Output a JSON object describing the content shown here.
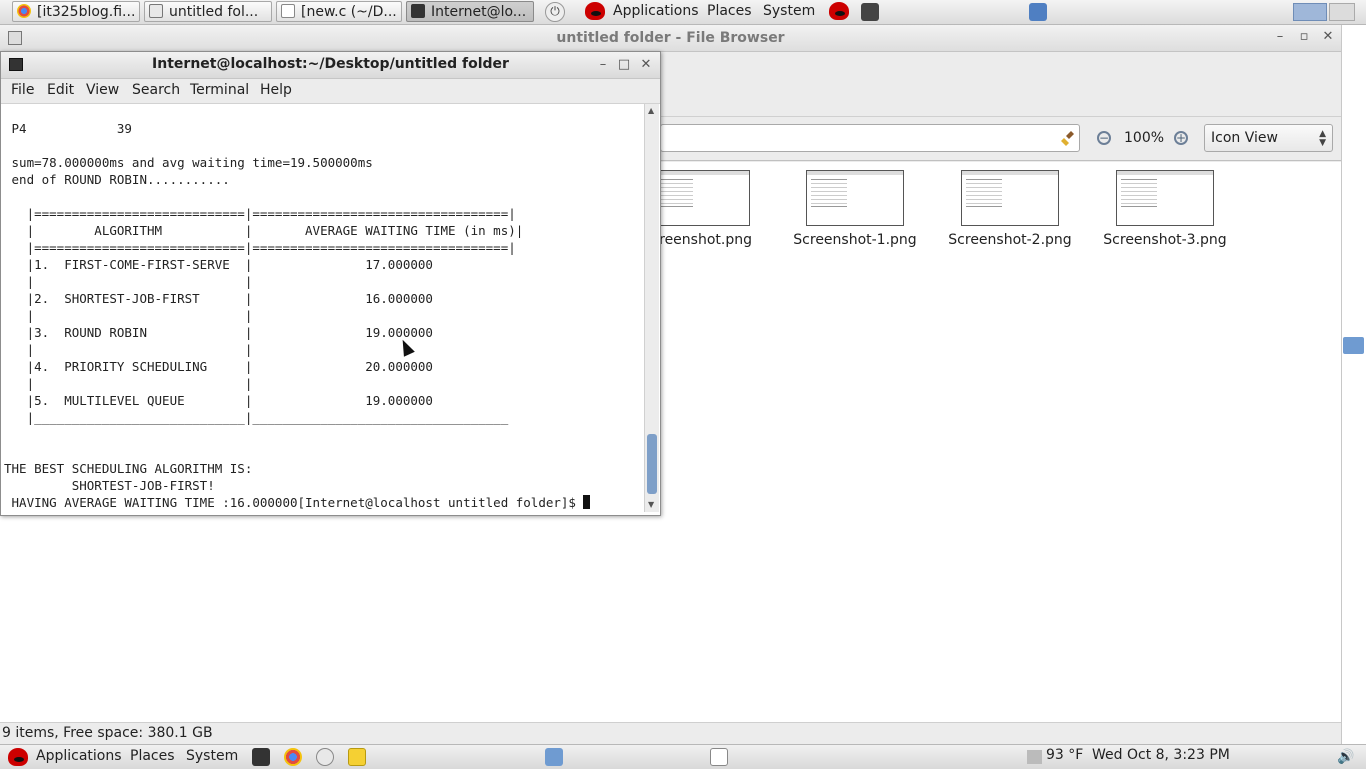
{
  "top_panel": {
    "tasks": [
      {
        "label": "[it325blog.fi..."
      },
      {
        "label": "untitled fol..."
      },
      {
        "label": "[new.c (~/D..."
      },
      {
        "label": "Internet@lo..."
      }
    ],
    "menus": {
      "applications": "Applications",
      "places": "Places",
      "system": "System"
    }
  },
  "file_browser": {
    "title": "untitled folder - File Browser",
    "zoom": "100%",
    "view_mode": "Icon View",
    "files": [
      {
        "name": "creenshot.png"
      },
      {
        "name": "Screenshot-1.png"
      },
      {
        "name": "Screenshot-2.png"
      },
      {
        "name": "Screenshot-3.png"
      }
    ],
    "status": "9 items, Free space: 380.1 GB"
  },
  "terminal": {
    "title": "Internet@localhost:~/Desktop/untitled folder",
    "menu": {
      "file": "File",
      "edit": "Edit",
      "view": "View",
      "search": "Search",
      "terminal": "Terminal",
      "help": "Help"
    },
    "lines": [
      " P4            39",
      "",
      " sum=78.000000ms and avg waiting time=19.500000ms",
      " end of ROUND ROBIN...........",
      "",
      "   |============================|==================================|",
      "   |        ALGORITHM           |       AVERAGE WAITING TIME (in ms)|",
      "   |============================|==================================|",
      "   |1.  FIRST-COME-FIRST-SERVE  |               17.000000",
      "   |                            |",
      "   |2.  SHORTEST-JOB-FIRST      |               16.000000",
      "   |                            |",
      "   |3.  ROUND ROBIN             |               19.000000",
      "   |                            |",
      "   |4.  PRIORITY SCHEDULING     |               20.000000",
      "   |                            |",
      "   |5.  MULTILEVEL QUEUE        |               19.000000",
      "   |____________________________|__________________________________",
      "",
      "",
      "THE BEST SCHEDULING ALGORITHM IS:",
      "         SHORTEST-JOB-FIRST!",
      " HAVING AVERAGE WAITING TIME :16.000000[Internet@localhost untitled folder]$ "
    ]
  },
  "bottom_panel": {
    "menus": {
      "applications": "Applications",
      "places": "Places",
      "system": "System"
    },
    "weather": "93 °F",
    "clock": "Wed Oct  8,  3:23 PM"
  }
}
